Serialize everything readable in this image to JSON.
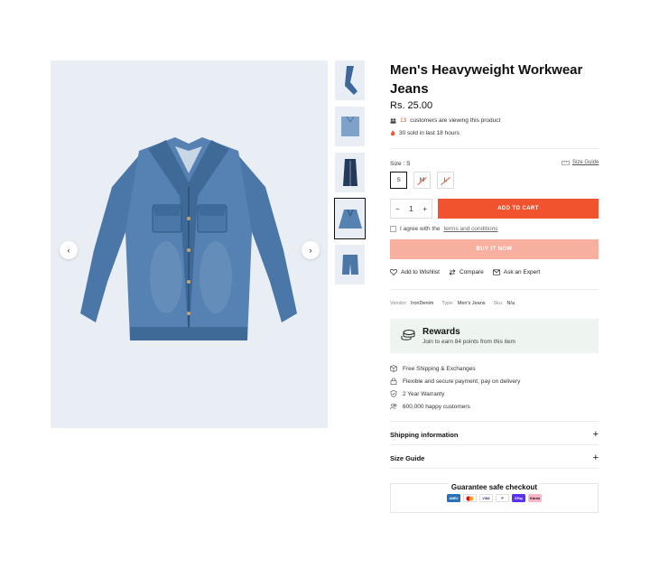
{
  "product": {
    "title": "Men's Heavyweight Workwear Jeans",
    "price": "Rs. 25.00",
    "viewing_count": "13",
    "viewing_text": "customers are viewing this product",
    "sold_text": "30 sold in last 18 hours"
  },
  "size": {
    "label": "Size :",
    "selected": "S",
    "guide_link": "Size Guide",
    "options": [
      "S",
      "M",
      "L"
    ]
  },
  "cart": {
    "qty_minus": "−",
    "qty_value": "1",
    "qty_plus": "+",
    "add_to_cart": "ADD TO CART",
    "terms_prefix": "I agree with the",
    "terms_link": "terms and conditions",
    "buy_now": "BUY IT NOW"
  },
  "actions": {
    "wishlist": "Add to Wishlist",
    "compare": "Compare",
    "expert": "Ask an Expert"
  },
  "meta": {
    "vendor_label": "Vendor:",
    "vendor": "IronDenim",
    "type_label": "Type:",
    "type": "Men's Jeans",
    "sku_label": "Sku:",
    "sku": "N/a"
  },
  "rewards": {
    "title": "Rewards",
    "subtitle": "Join to earn 84 points from this item"
  },
  "features": [
    "Free Shipping & Exchanges",
    "Flexible and secure payment, pay on delivery",
    "2 Year Warranty",
    "600,000 happy customers"
  ],
  "accordions": {
    "shipping": "Shipping information",
    "size_guide": "Size Guide",
    "toggle": "+"
  },
  "checkout": {
    "title": "Guarantee safe checkout",
    "payments": [
      "AMEX",
      "MC",
      "VISA",
      "P",
      "GPay",
      "Klarna"
    ]
  },
  "colors": {
    "accent": "#f1532f",
    "buy_now": "#f7b09f",
    "rewards_bg": "#eef4ef",
    "image_bg": "#e9eef4"
  },
  "gallery": {
    "prev_icon": "‹",
    "next_icon": "›"
  }
}
